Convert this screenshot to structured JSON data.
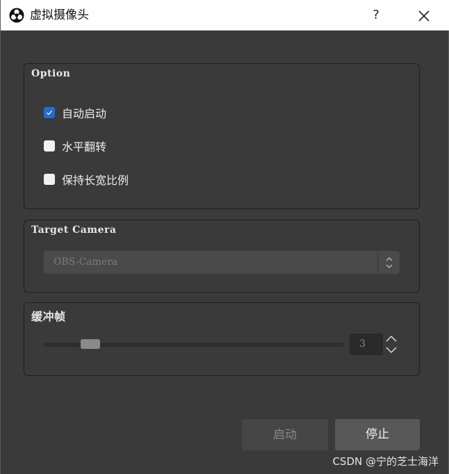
{
  "window": {
    "title": "虚拟摄像头",
    "help_label": "?",
    "app_icon": "obs-logo-icon",
    "close_icon": "close-icon"
  },
  "option_group": {
    "title": "Option",
    "checkboxes": [
      {
        "label": "自动启动",
        "checked": true
      },
      {
        "label": "水平翻转",
        "checked": false
      },
      {
        "label": "保持长宽比例",
        "checked": false
      }
    ]
  },
  "camera_group": {
    "title": "Target Camera",
    "selected_value": "OBS-Camera",
    "arrows_icon": "up-down-chevron-icon"
  },
  "buffer_group": {
    "title": "缓冲帧",
    "value": "3",
    "slider_fraction": 0.13
  },
  "buttons": {
    "start_label": "启动",
    "stop_label": "停止"
  },
  "watermark": "CSDN @宁的芝士海洋",
  "colors": {
    "checkbox_on": "#1f6fd1",
    "background": "#3a3a3a",
    "titlebar": "#ffffff"
  }
}
